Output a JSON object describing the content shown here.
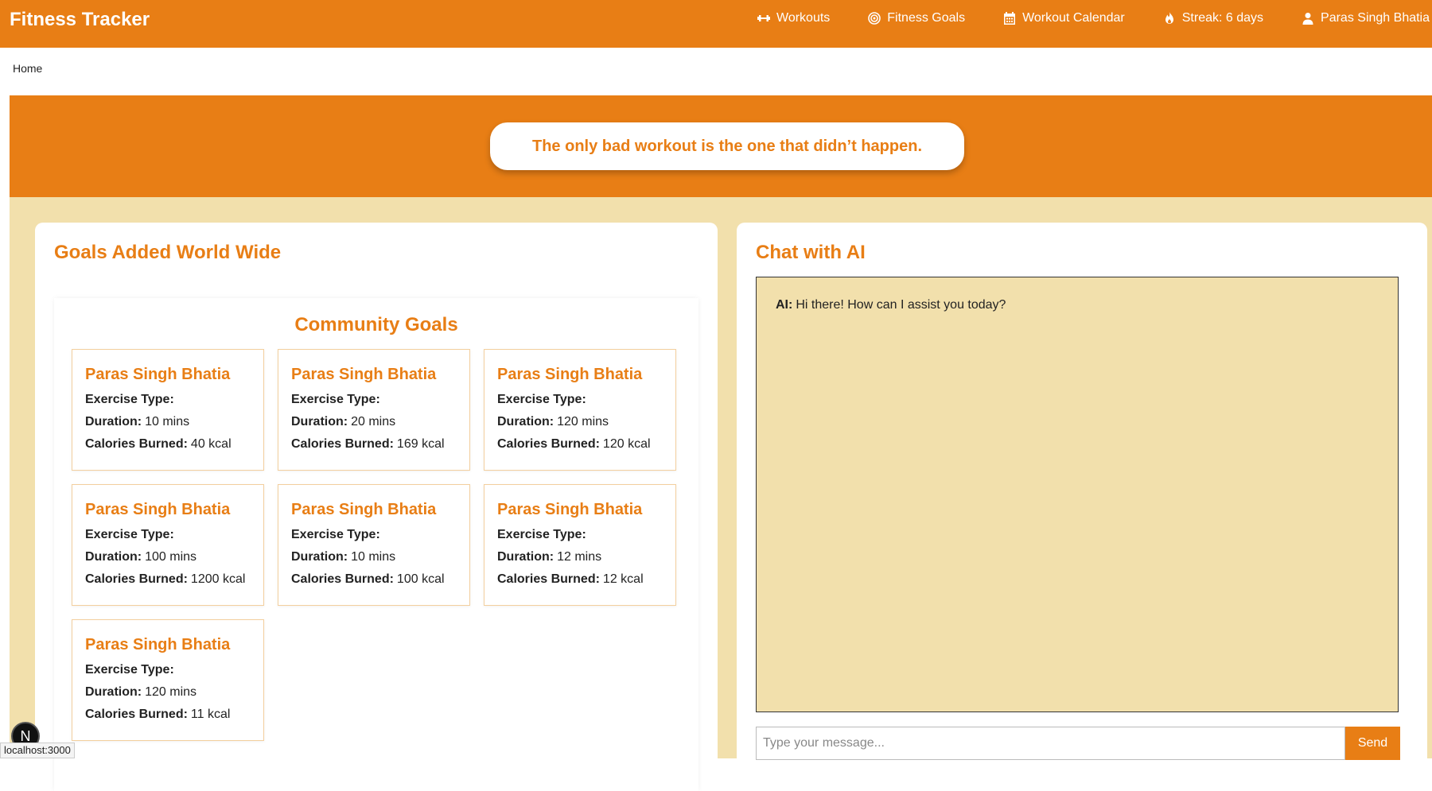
{
  "app": {
    "title": "Fitness Tracker"
  },
  "nav": {
    "items": [
      {
        "label": "Workouts",
        "icon": "dumbbell-icon"
      },
      {
        "label": "Fitness Goals",
        "icon": "target-icon"
      },
      {
        "label": "Workout Calendar",
        "icon": "calendar-icon"
      },
      {
        "label": "Streak: 6 days",
        "icon": "fire-icon"
      },
      {
        "label": "Paras Singh Bhatia",
        "icon": "user-icon"
      }
    ]
  },
  "breadcrumb": {
    "home": "Home"
  },
  "hero": {
    "quote": "The only bad workout is the one that didn’t happen."
  },
  "goals_panel": {
    "title": "Goals Added World Wide",
    "community_title": "Community Goals",
    "labels": {
      "exercise": "Exercise Type:",
      "duration": "Duration:",
      "calories": "Calories Burned:"
    },
    "cards": [
      {
        "name": "Paras Singh Bhatia",
        "exercise": "",
        "duration": "10 mins",
        "calories": "40 kcal"
      },
      {
        "name": "Paras Singh Bhatia",
        "exercise": "",
        "duration": "20 mins",
        "calories": "169 kcal"
      },
      {
        "name": "Paras Singh Bhatia",
        "exercise": "",
        "duration": "120 mins",
        "calories": "120 kcal"
      },
      {
        "name": "Paras Singh Bhatia",
        "exercise": "",
        "duration": "100 mins",
        "calories": "1200 kcal"
      },
      {
        "name": "Paras Singh Bhatia",
        "exercise": "",
        "duration": "10 mins",
        "calories": "100 kcal"
      },
      {
        "name": "Paras Singh Bhatia",
        "exercise": "",
        "duration": "12 mins",
        "calories": "12 kcal"
      },
      {
        "name": "Paras Singh Bhatia",
        "exercise": "",
        "duration": "120 mins",
        "calories": "11 kcal"
      }
    ]
  },
  "chat": {
    "title": "Chat with AI",
    "messages": [
      {
        "sender": "AI:",
        "text": "Hi there! How can I assist you today?"
      }
    ],
    "input_placeholder": "Type your message...",
    "input_value": "",
    "send_label": "Send"
  },
  "dev_badge": {
    "label": "N"
  },
  "status_bar": {
    "url": "localhost:3000"
  },
  "colors": {
    "accent": "#e87e15",
    "background": "#f2e0ac",
    "card_border": "#f3cf9e"
  }
}
